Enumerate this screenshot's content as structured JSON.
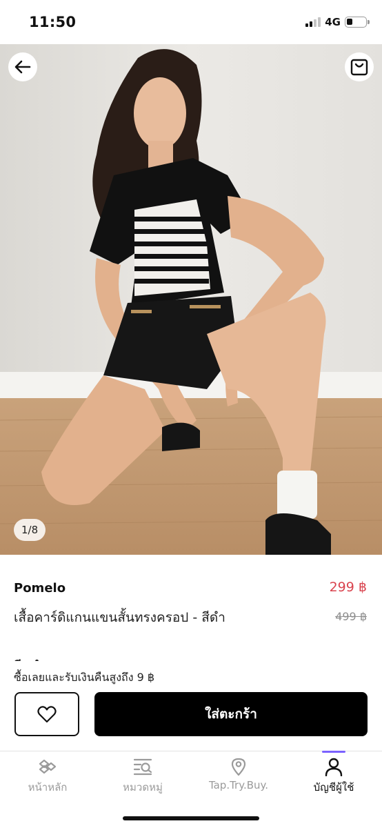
{
  "status_bar": {
    "time": "11:50",
    "network": "4G",
    "signal_bars_active": 2,
    "battery_level": 0.3
  },
  "product_image": {
    "counter": "1/8",
    "back_icon": "arrow-left-icon",
    "bag_icon": "shopping-bag-icon"
  },
  "product": {
    "brand": "Pomelo",
    "price": "299 ฿",
    "title": "เสื้อคาร์ดิแกนแขนสั้นทรงครอป - สีดำ",
    "original_price": "499 ฿",
    "color_label_partial": "สี: ดำ"
  },
  "purchase": {
    "cashback_text": "ซื้อเลยและรับเงินคืนสูงถึง 9 ฿",
    "add_to_cart_label": "ใส่ตะกร้า",
    "wishlist_icon": "heart-icon"
  },
  "bottom_nav": {
    "items": [
      {
        "label": "หน้าหลัก",
        "icon": "home-logo-icon",
        "active": false
      },
      {
        "label": "หมวดหมู่",
        "icon": "category-search-icon",
        "active": false
      },
      {
        "label": "Tap.Try.Buy.",
        "icon": "location-pin-icon",
        "active": false
      },
      {
        "label": "บัญชีผู้ใช้",
        "icon": "user-icon",
        "active": true
      }
    ]
  },
  "colors": {
    "price_red": "#d9434e",
    "active_accent": "#7b61ff",
    "button_black": "#000000"
  }
}
